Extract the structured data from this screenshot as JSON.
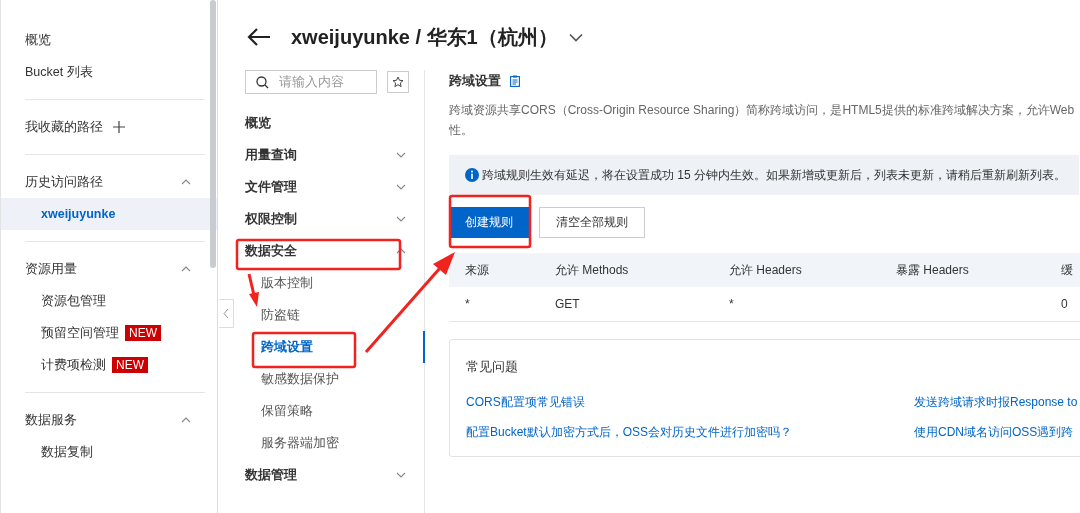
{
  "sidebar": {
    "sections": [
      {
        "kind": "plain",
        "items": [
          {
            "label": "概览",
            "selected": false
          },
          {
            "label": "Bucket 列表",
            "selected": false
          }
        ]
      },
      {
        "kind": "add",
        "title": "我收藏的路径"
      },
      {
        "kind": "collapsible",
        "title": "历史访问路径",
        "expanded": true,
        "items": [
          {
            "label": "xweijuyunke",
            "selected": true
          }
        ]
      },
      {
        "kind": "collapsible",
        "title": "资源用量",
        "expanded": true,
        "items": [
          {
            "label": "资源包管理",
            "selected": false
          },
          {
            "label": "预留空间管理",
            "badge": "NEW",
            "selected": false
          },
          {
            "label": "计费项检测",
            "badge": "NEW",
            "selected": false
          }
        ]
      },
      {
        "kind": "collapsible",
        "title": "数据服务",
        "expanded": true,
        "items": [
          {
            "label": "数据复制",
            "selected": false
          }
        ]
      }
    ]
  },
  "header": {
    "title": "xweijuyunke / 华东1（杭州）"
  },
  "subnav": {
    "search": {
      "placeholder": "请输入内容"
    },
    "items": [
      {
        "kind": "leaf",
        "label": "概览"
      },
      {
        "kind": "group",
        "label": "用量查询",
        "expanded": false
      },
      {
        "kind": "group",
        "label": "文件管理",
        "expanded": false
      },
      {
        "kind": "group",
        "label": "权限控制",
        "expanded": false
      },
      {
        "kind": "group",
        "label": "数据安全",
        "expanded": true,
        "children": [
          {
            "label": "版本控制",
            "selected": false
          },
          {
            "label": "防盗链",
            "selected": false
          },
          {
            "label": "跨域设置",
            "selected": true
          },
          {
            "label": "敏感数据保护",
            "selected": false
          },
          {
            "label": "保留策略",
            "selected": false
          },
          {
            "label": "服务器端加密",
            "selected": false
          }
        ]
      },
      {
        "kind": "group",
        "label": "数据管理",
        "expanded": false
      }
    ]
  },
  "content": {
    "title": "跨域设置",
    "description": [
      "跨域资源共享CORS（Cross-Origin Resource Sharing）简称跨域访问，是HTML5提供的标准跨域解决方案，允许Web",
      "性。"
    ],
    "notice": "跨域规则生效有延迟，将在设置成功 15 分钟内生效。如果新增或更新后，列表未更新，请稍后重新刷新列表。",
    "buttons": [
      {
        "label": "创建规则",
        "kind": "primary"
      },
      {
        "label": "清空全部规则",
        "kind": "secondary"
      }
    ],
    "table": {
      "columns": [
        "来源",
        "允许 Methods",
        "允许 Headers",
        "暴露 Headers",
        "缓"
      ],
      "rows": [
        [
          "*",
          "GET",
          "*",
          "",
          "0"
        ]
      ]
    },
    "faq": {
      "title": "常见问题",
      "links": [
        [
          "CORS配置项常见错误",
          "发送跨域请求时报Response to"
        ],
        [
          "配置Bucket默认加密方式后，OSS会对历史文件进行加密吗？",
          "使用CDN域名访问OSS遇到跨"
        ]
      ]
    }
  }
}
